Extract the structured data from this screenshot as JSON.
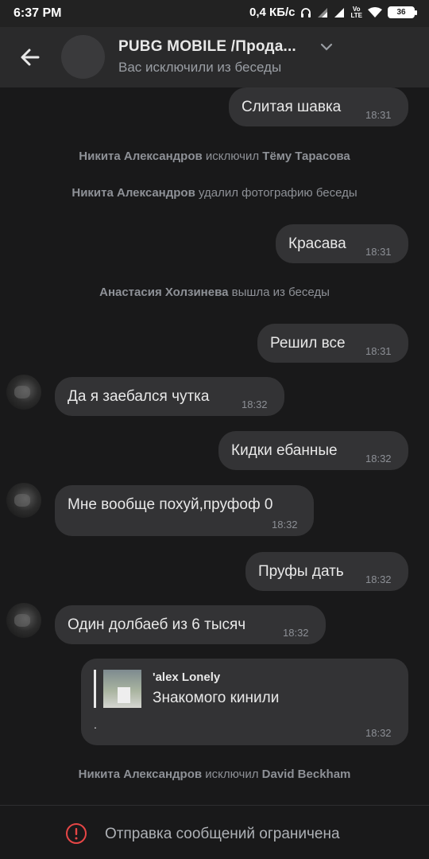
{
  "status_bar": {
    "time": "6:37 PM",
    "network_speed": "0,4 КБ/с",
    "network_type": "Vo LTE",
    "battery": "36"
  },
  "header": {
    "title": "PUBG MOBILE /Прода...",
    "subtitle": "Вас исключили из беседы"
  },
  "messages": [
    {
      "type": "out",
      "text": "Слитая шавка",
      "time": "18:31"
    },
    {
      "type": "service",
      "actor": "Никита Александров",
      "action": "исключил",
      "target": "Тёму Тарасова"
    },
    {
      "type": "service",
      "actor": "Никита Александров",
      "action": "удалил фотографию беседы",
      "target": ""
    },
    {
      "type": "out",
      "text": "Красава",
      "time": "18:31"
    },
    {
      "type": "service",
      "actor": "Анастасия Холзинева",
      "action": "вышла из беседы",
      "target": ""
    },
    {
      "type": "out",
      "text": "Решил все",
      "time": "18:31"
    },
    {
      "type": "in",
      "text": "Да я заебался чутка",
      "time": "18:32"
    },
    {
      "type": "out",
      "text": "Кидки ебанные",
      "time": "18:32"
    },
    {
      "type": "in",
      "text": "Мне вообще похуй,пруфоф 0",
      "time": "18:32"
    },
    {
      "type": "out",
      "text": "Пруфы дать",
      "time": "18:32"
    },
    {
      "type": "in",
      "text": "Один долбаеб из 6 тысяч",
      "time": "18:32"
    },
    {
      "type": "out-reply",
      "reply_author": "'alex Lonely",
      "reply_text": "Знакомого кинили",
      "text": ".",
      "time": "18:32"
    },
    {
      "type": "service",
      "actor": "Никита Александров",
      "action": "исключил",
      "target": "David Beckham"
    }
  ],
  "footer": {
    "text": "Отправка сообщений ограничена"
  },
  "colors": {
    "background": "#19191a",
    "bubble": "#333335",
    "header": "#2a2a2b",
    "warning": "#e64646"
  }
}
